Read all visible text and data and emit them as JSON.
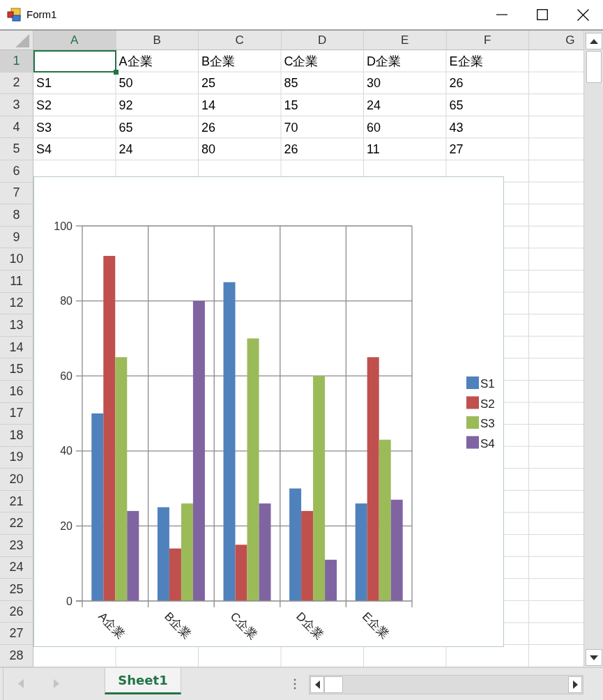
{
  "window": {
    "title": "Form1"
  },
  "sheet": {
    "columns": [
      {
        "label": "A",
        "selected": true
      },
      {
        "label": "B",
        "selected": false
      },
      {
        "label": "C",
        "selected": false
      },
      {
        "label": "D",
        "selected": false
      },
      {
        "label": "E",
        "selected": false
      },
      {
        "label": "F",
        "selected": false
      },
      {
        "label": "G",
        "selected": false
      }
    ],
    "rows": [
      {
        "header": "1",
        "selected": true,
        "cells": [
          null,
          "A企業",
          "B企業",
          "C企業",
          "D企業",
          "E企業"
        ]
      },
      {
        "header": "2",
        "selected": false,
        "cells": [
          "S1",
          "50",
          "25",
          "85",
          "30",
          "26"
        ]
      },
      {
        "header": "3",
        "selected": false,
        "cells": [
          "S2",
          "92",
          "14",
          "15",
          "24",
          "65"
        ]
      },
      {
        "header": "4",
        "selected": false,
        "cells": [
          "S3",
          "65",
          "26",
          "70",
          "60",
          "43"
        ]
      },
      {
        "header": "5",
        "selected": false,
        "cells": [
          "S4",
          "24",
          "80",
          "26",
          "11",
          "27"
        ]
      },
      {
        "header": "6",
        "selected": false
      },
      {
        "header": "7",
        "selected": false
      },
      {
        "header": "8",
        "selected": false
      },
      {
        "header": "9",
        "selected": false
      },
      {
        "header": "10",
        "selected": false
      },
      {
        "header": "11",
        "selected": false
      },
      {
        "header": "12",
        "selected": false
      },
      {
        "header": "13",
        "selected": false
      },
      {
        "header": "14",
        "selected": false
      },
      {
        "header": "15",
        "selected": false
      },
      {
        "header": "16",
        "selected": false
      },
      {
        "header": "17",
        "selected": false
      },
      {
        "header": "18",
        "selected": false
      },
      {
        "header": "19",
        "selected": false
      },
      {
        "header": "20",
        "selected": false
      },
      {
        "header": "21",
        "selected": false
      },
      {
        "header": "22",
        "selected": false
      },
      {
        "header": "23",
        "selected": false
      },
      {
        "header": "24",
        "selected": false
      },
      {
        "header": "25",
        "selected": false
      },
      {
        "header": "26",
        "selected": false
      },
      {
        "header": "27",
        "selected": false
      },
      {
        "header": "28",
        "selected": false
      }
    ],
    "chart": {
      "chart_data": {
        "type": "bar",
        "categories": [
          "A企業",
          "B企業",
          "C企業",
          "D企業",
          "E企業"
        ],
        "series": [
          {
            "name": "S1",
            "color": "#4f81bd",
            "values": [
              50,
              25,
              85,
              30,
              26
            ]
          },
          {
            "name": "S2",
            "color": "#c0504d",
            "values": [
              92,
              14,
              15,
              24,
              65
            ]
          },
          {
            "name": "S3",
            "color": "#9bbb59",
            "values": [
              65,
              26,
              70,
              60,
              43
            ]
          },
          {
            "name": "S4",
            "color": "#8064a2",
            "values": [
              24,
              80,
              26,
              11,
              27
            ]
          }
        ],
        "ylim": [
          0,
          100
        ],
        "yticks": [
          0,
          20,
          40,
          60,
          80,
          100
        ],
        "grid": true,
        "legend": "right"
      }
    }
  },
  "sheet_tabs": [
    {
      "label": "Sheet1",
      "selected": true
    }
  ]
}
